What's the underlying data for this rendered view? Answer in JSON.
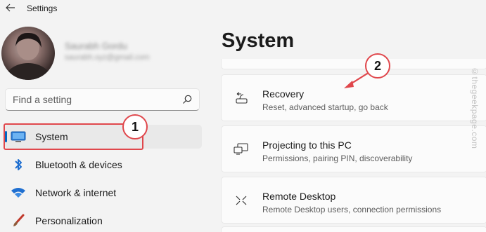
{
  "app": {
    "title": "Settings"
  },
  "profile": {
    "name": "Saurabh Gordu",
    "email": "saurabh.xyz@gmail.com"
  },
  "search": {
    "placeholder": "Find a setting"
  },
  "nav": {
    "items": [
      {
        "label": "System",
        "icon": "monitor-icon",
        "active": true
      },
      {
        "label": "Bluetooth & devices",
        "icon": "bluetooth-icon"
      },
      {
        "label": "Network & internet",
        "icon": "wifi-icon"
      },
      {
        "label": "Personalization",
        "icon": "brush-icon"
      }
    ]
  },
  "main": {
    "title": "System",
    "cards": [
      {
        "title": "Recovery",
        "desc": "Reset, advanced startup, go back",
        "icon": "recovery-icon"
      },
      {
        "title": "Projecting to this PC",
        "desc": "Permissions, pairing PIN, discoverability",
        "icon": "projector-icon"
      },
      {
        "title": "Remote Desktop",
        "desc": "Remote Desktop users, connection permissions",
        "icon": "remote-desktop-icon"
      }
    ]
  },
  "annotations": {
    "step1": "1",
    "step2": "2"
  },
  "watermark": "©thegeekpage.com",
  "colors": {
    "accent": "#0067c0",
    "annotation": "#e0474c"
  }
}
